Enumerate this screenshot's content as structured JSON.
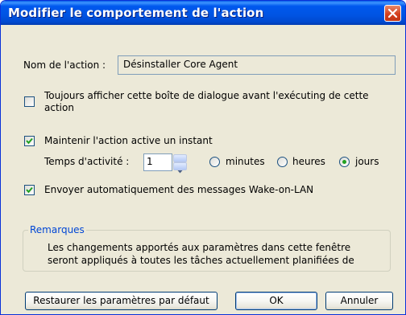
{
  "window": {
    "title": "Modifier le comportement de l'action"
  },
  "action_name": {
    "label": "Nom de l'action :",
    "value": "Désinstaller Core Agent"
  },
  "always_show_dialog": {
    "label_line1": "Toujours afficher cette boîte de dialogue avant l'exécuting de cette",
    "label_line2": "action",
    "checked": false
  },
  "keep_active": {
    "label": "Maintenir l'action active un instant",
    "checked": true
  },
  "activity_time": {
    "label": "Temps d'activité :",
    "value": "1",
    "units": [
      {
        "label": "minutes",
        "selected": false
      },
      {
        "label": "heures",
        "selected": false
      },
      {
        "label": "jours",
        "selected": true
      }
    ]
  },
  "wake_on_lan": {
    "label": "Envoyer automatiquement des messages Wake-on-LAN",
    "checked": true
  },
  "remarks": {
    "title": "Remarques",
    "line1": "Les changements apportés aux paramètres dans cette fenêtre",
    "line2": "seront appliqués à toutes les tâches actuellement planifiées de"
  },
  "buttons": {
    "restore": "Restaurer les paramètres par défaut",
    "ok": "OK",
    "cancel": "Annuler"
  },
  "colors": {
    "title_bar": "#0054e3",
    "dialog_bg": "#ece9d8",
    "group_title": "#0046d5",
    "radio_dot": "#21a121"
  }
}
